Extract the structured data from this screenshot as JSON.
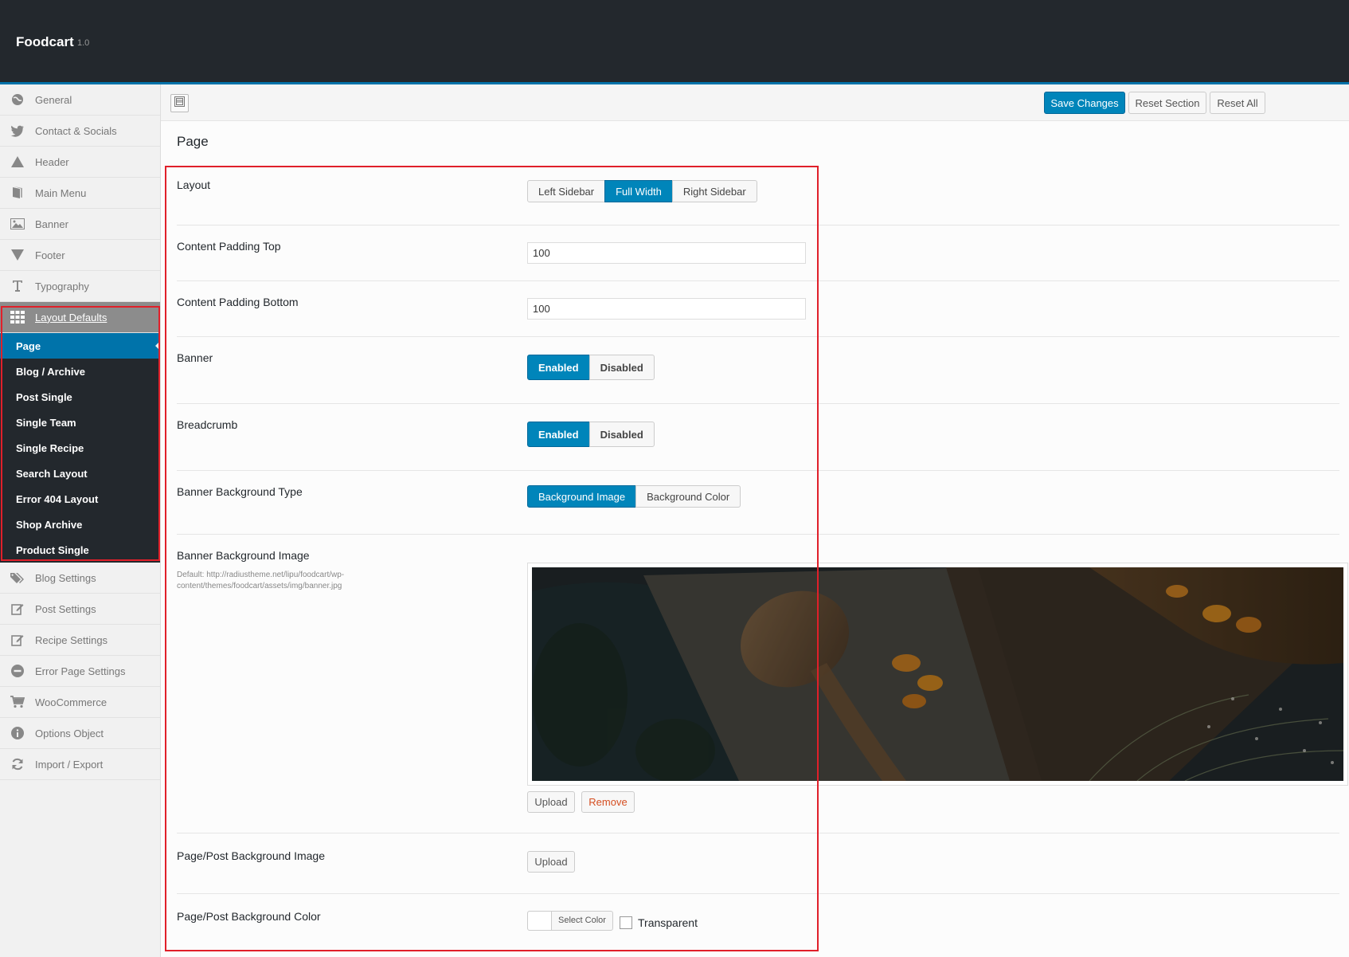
{
  "header": {
    "brand": "Foodcart",
    "version": "1.0"
  },
  "sidebar": {
    "top_items": [
      {
        "label": "General",
        "icon": "globe-icon"
      },
      {
        "label": "Contact & Socials",
        "icon": "twitter-icon"
      },
      {
        "label": "Header",
        "icon": "triangle-up-icon"
      },
      {
        "label": "Main Menu",
        "icon": "book-icon"
      },
      {
        "label": "Banner",
        "icon": "image-icon"
      },
      {
        "label": "Footer",
        "icon": "triangle-down-icon"
      },
      {
        "label": "Typography",
        "icon": "text-icon"
      },
      {
        "label": "Layout Defaults",
        "icon": "grid-icon"
      }
    ],
    "sub_items": [
      {
        "label": "Page"
      },
      {
        "label": "Blog / Archive"
      },
      {
        "label": "Post Single"
      },
      {
        "label": "Single Team"
      },
      {
        "label": "Single Recipe"
      },
      {
        "label": "Search Layout"
      },
      {
        "label": "Error 404 Layout"
      },
      {
        "label": "Shop Archive"
      },
      {
        "label": "Product Single"
      }
    ],
    "bottom_items": [
      {
        "label": "Blog Settings",
        "icon": "tags-icon"
      },
      {
        "label": "Post Settings",
        "icon": "edit-icon"
      },
      {
        "label": "Recipe Settings",
        "icon": "edit-icon"
      },
      {
        "label": "Error Page Settings",
        "icon": "minus-circle-icon"
      },
      {
        "label": "WooCommerce",
        "icon": "cart-icon"
      },
      {
        "label": "Options Object",
        "icon": "info-icon"
      },
      {
        "label": "Import / Export",
        "icon": "refresh-icon"
      }
    ]
  },
  "toolbar": {
    "save_label": "Save Changes",
    "reset_section_label": "Reset Section",
    "reset_all_label": "Reset All"
  },
  "page": {
    "title": "Page",
    "layout": {
      "label": "Layout",
      "options": [
        "Left Sidebar",
        "Full Width",
        "Right Sidebar"
      ],
      "selected": "Full Width"
    },
    "padding_top": {
      "label": "Content Padding Top",
      "value": "100"
    },
    "padding_bottom": {
      "label": "Content Padding Bottom",
      "value": "100"
    },
    "banner": {
      "label": "Banner",
      "options": [
        "Enabled",
        "Disabled"
      ],
      "selected": "Enabled"
    },
    "breadcrumb": {
      "label": "Breadcrumb",
      "options": [
        "Enabled",
        "Disabled"
      ],
      "selected": "Enabled"
    },
    "banner_bg_type": {
      "label": "Banner Background Type",
      "options": [
        "Background Image",
        "Background Color"
      ],
      "selected": "Background Image"
    },
    "banner_bg_image": {
      "label": "Banner Background Image",
      "default_text": "Default: http://radiustheme.net/lipu/foodcart/wp-content/themes/foodcart/assets/img/banner.jpg",
      "upload_label": "Upload",
      "remove_label": "Remove"
    },
    "page_bg_image": {
      "label": "Page/Post Background Image",
      "upload_label": "Upload"
    },
    "page_bg_color": {
      "label": "Page/Post Background Color",
      "select_label": "Select Color",
      "transparent_label": "Transparent"
    }
  },
  "colors": {
    "accent": "#0085ba",
    "dark": "#23282d",
    "remove": "#d54e21",
    "highlight": "#e0202a"
  }
}
